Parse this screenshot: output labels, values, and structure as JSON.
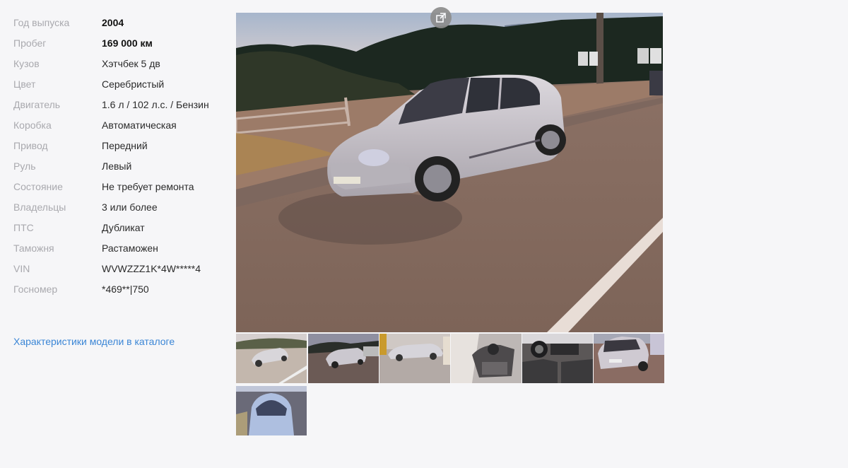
{
  "specs": [
    {
      "label": "Год выпуска",
      "value": "2004",
      "bold": true
    },
    {
      "label": "Пробег",
      "value": "169 000 км",
      "bold": true
    },
    {
      "label": "Кузов",
      "value": "Хэтчбек 5 дв"
    },
    {
      "label": "Цвет",
      "value": "Серебристый"
    },
    {
      "label": "Двигатель",
      "value": "1.6 л / 102 л.с. / Бензин"
    },
    {
      "label": "Коробка",
      "value": "Автоматическая"
    },
    {
      "label": "Привод",
      "value": "Передний"
    },
    {
      "label": "Руль",
      "value": "Левый"
    },
    {
      "label": "Состояние",
      "value": "Не требует ремонта"
    },
    {
      "label": "Владельцы",
      "value": "3 или более"
    },
    {
      "label": "ПТС",
      "value": "Дубликат"
    },
    {
      "label": "Таможня",
      "value": "Растаможен"
    },
    {
      "label": "VIN",
      "value": "WVWZZZ1K*4W*****4"
    },
    {
      "label": "Госномер",
      "value": "*469**|750"
    }
  ],
  "catalog_link": "Характеристики модели в каталоге",
  "gallery": {
    "expand_icon": "external-expand-icon",
    "thumbnail_count": 7,
    "colors": {
      "link": "#3b86d6",
      "label": "#a9a9ae",
      "car_body": "#c9c6cc"
    }
  }
}
